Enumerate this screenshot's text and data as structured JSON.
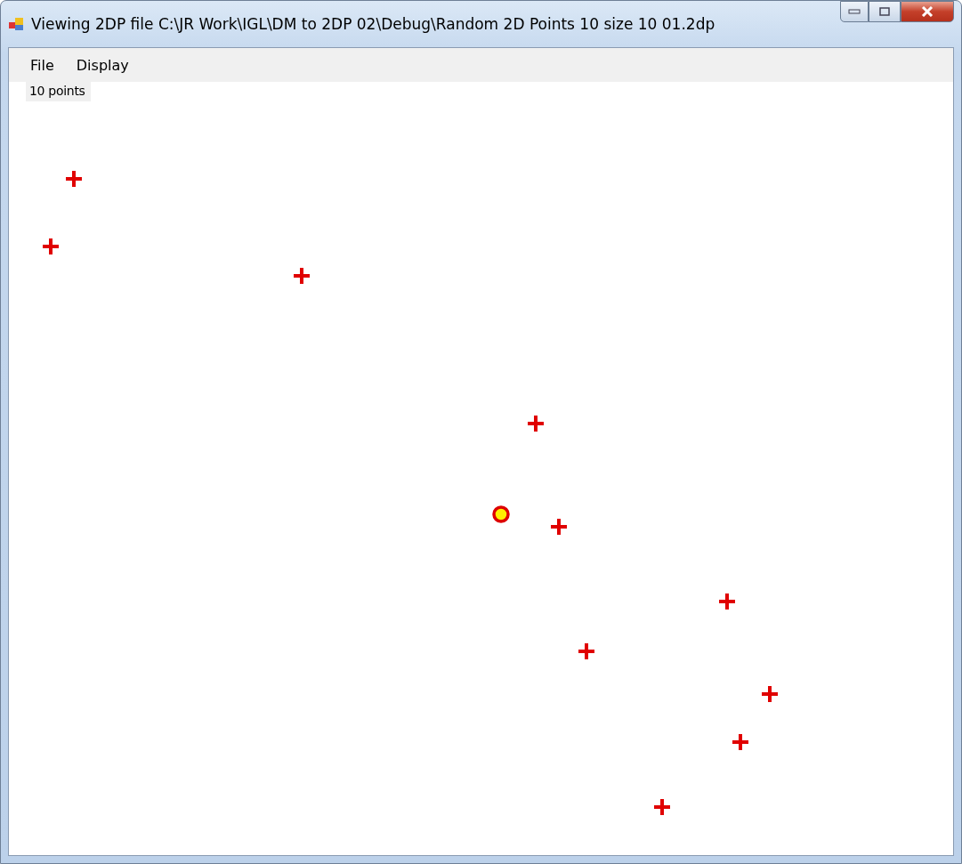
{
  "window": {
    "title": "Viewing 2DP file C:\\JR Work\\IGL\\DM to 2DP 02\\Debug\\Random 2D Points 10 size 10 01.2dp"
  },
  "menu": [
    "File",
    "Display"
  ],
  "status_label": "10 points",
  "canvas": {
    "markers": [
      {
        "kind": "cross"
      },
      {
        "kind": "cross"
      },
      {
        "kind": "cross"
      },
      {
        "kind": "cross"
      },
      {
        "kind": "cross"
      },
      {
        "kind": "cross"
      },
      {
        "kind": "cross"
      },
      {
        "kind": "cross"
      },
      {
        "kind": "cross"
      },
      {
        "kind": "cross"
      },
      {
        "kind": "circle"
      }
    ]
  }
}
